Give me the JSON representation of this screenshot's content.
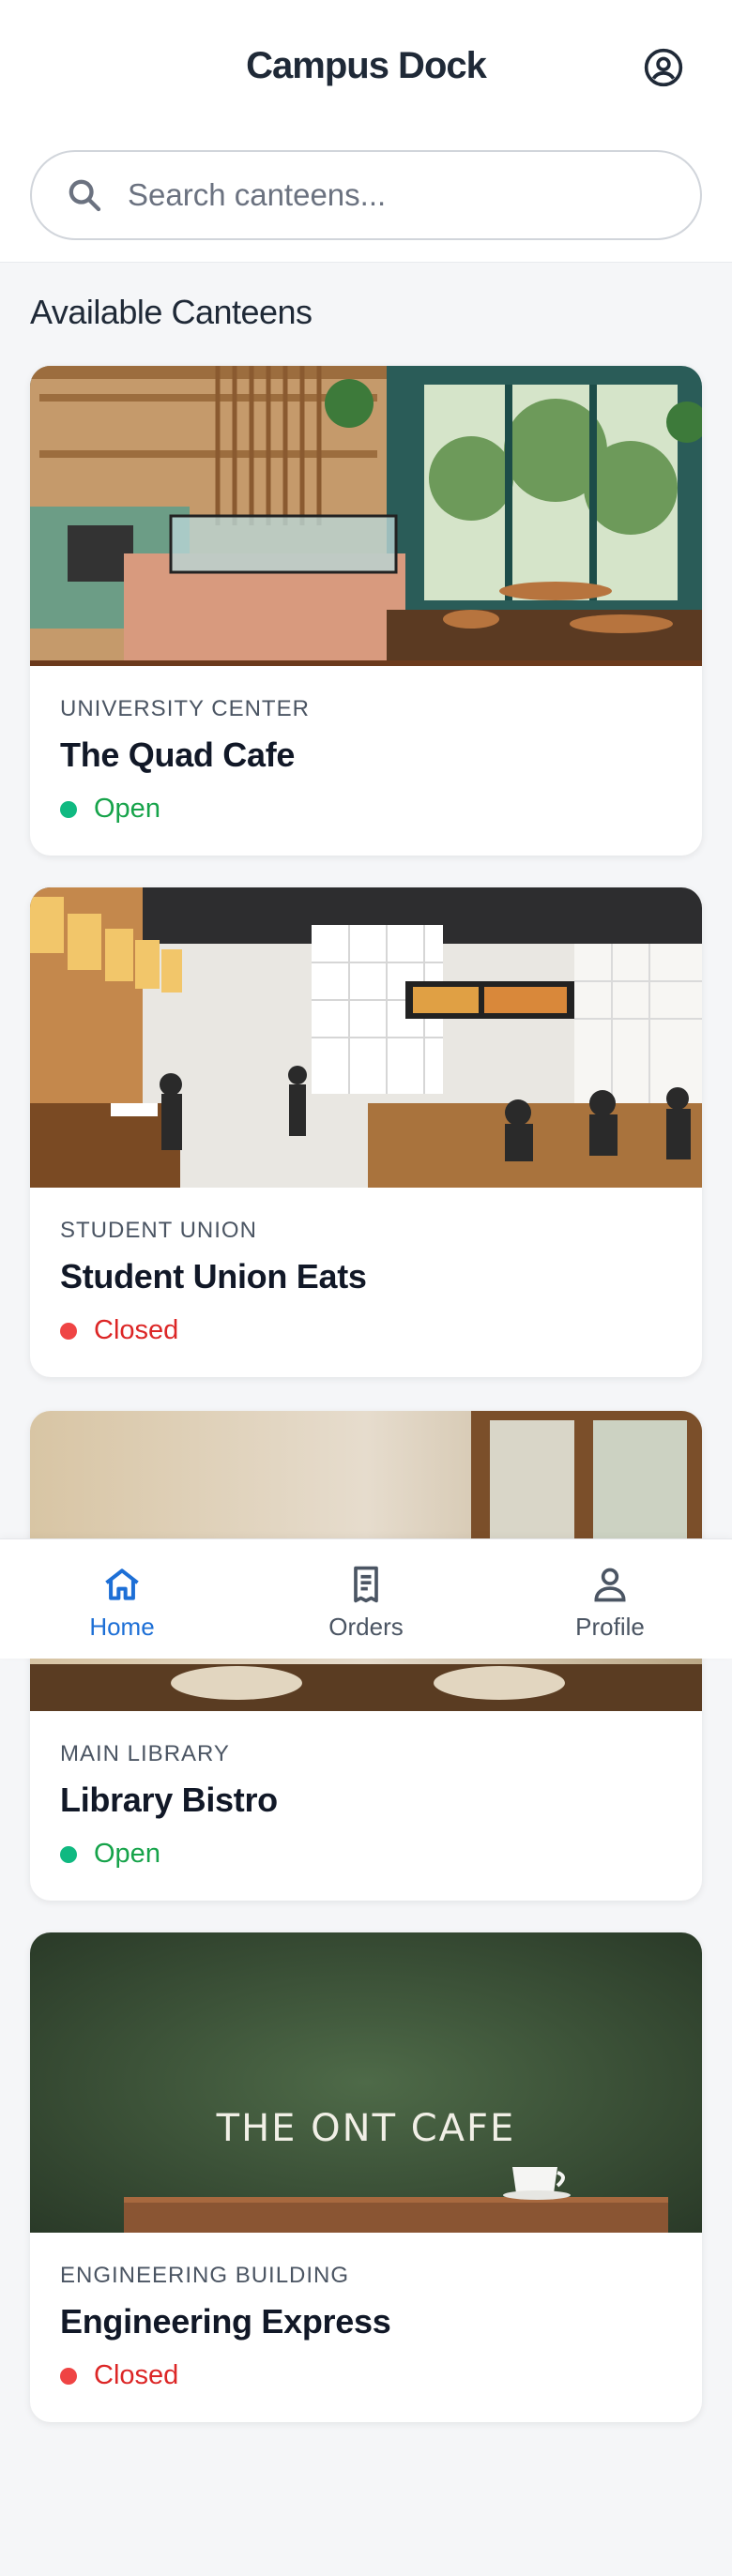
{
  "header": {
    "title": "Campus Dock",
    "profile_icon": "user-circle-icon"
  },
  "search": {
    "placeholder": "Search canteens...",
    "value": ""
  },
  "section": {
    "title": "Available Canteens"
  },
  "canteens": [
    {
      "location": "UNIVERSITY CENTER",
      "name": "The Quad Cafe",
      "status": "Open",
      "status_color": "#10b981"
    },
    {
      "location": "STUDENT UNION",
      "name": "Student Union Eats",
      "status": "Closed",
      "status_color": "#ef4444"
    },
    {
      "location": "MAIN LIBRARY",
      "name": "Library Bistro",
      "status": "Open",
      "status_color": "#10b981"
    },
    {
      "location": "ENGINEERING BUILDING",
      "name": "Engineering Express",
      "status": "Closed",
      "status_color": "#ef4444"
    }
  ],
  "card4_sign": "THE ONT CAFE",
  "bottom_nav": {
    "items": [
      {
        "label": "Home",
        "icon": "home-icon",
        "active": true
      },
      {
        "label": "Orders",
        "icon": "receipt-icon",
        "active": false
      },
      {
        "label": "Profile",
        "icon": "person-icon",
        "active": false
      }
    ]
  },
  "colors": {
    "accent": "#1d6fd6",
    "open": "#10b981",
    "closed": "#ef4444",
    "background": "#f5f6f8"
  }
}
